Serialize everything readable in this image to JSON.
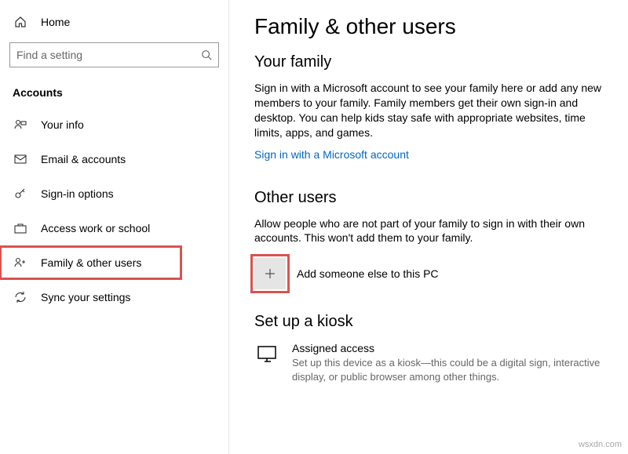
{
  "sidebar": {
    "home_label": "Home",
    "search_placeholder": "Find a setting",
    "section_label": "Accounts",
    "items": [
      {
        "label": "Your info"
      },
      {
        "label": "Email & accounts"
      },
      {
        "label": "Sign-in options"
      },
      {
        "label": "Access work or school"
      },
      {
        "label": "Family & other users"
      },
      {
        "label": "Sync your settings"
      }
    ]
  },
  "main": {
    "title": "Family & other users",
    "family": {
      "heading": "Your family",
      "body": "Sign in with a Microsoft account to see your family here or add any new members to your family. Family members get their own sign-in and desktop. You can help kids stay safe with appropriate websites, time limits, apps, and games.",
      "link_text": "Sign in with a Microsoft account"
    },
    "other": {
      "heading": "Other users",
      "body": "Allow people who are not part of your family to sign in with their own accounts. This won't add them to your family.",
      "add_label": "Add someone else to this PC"
    },
    "kiosk": {
      "heading": "Set up a kiosk",
      "item_title": "Assigned access",
      "item_desc": "Set up this device as a kiosk—this could be a digital sign, interactive display, or public browser among other things."
    }
  },
  "watermark": "wsxdn.com"
}
